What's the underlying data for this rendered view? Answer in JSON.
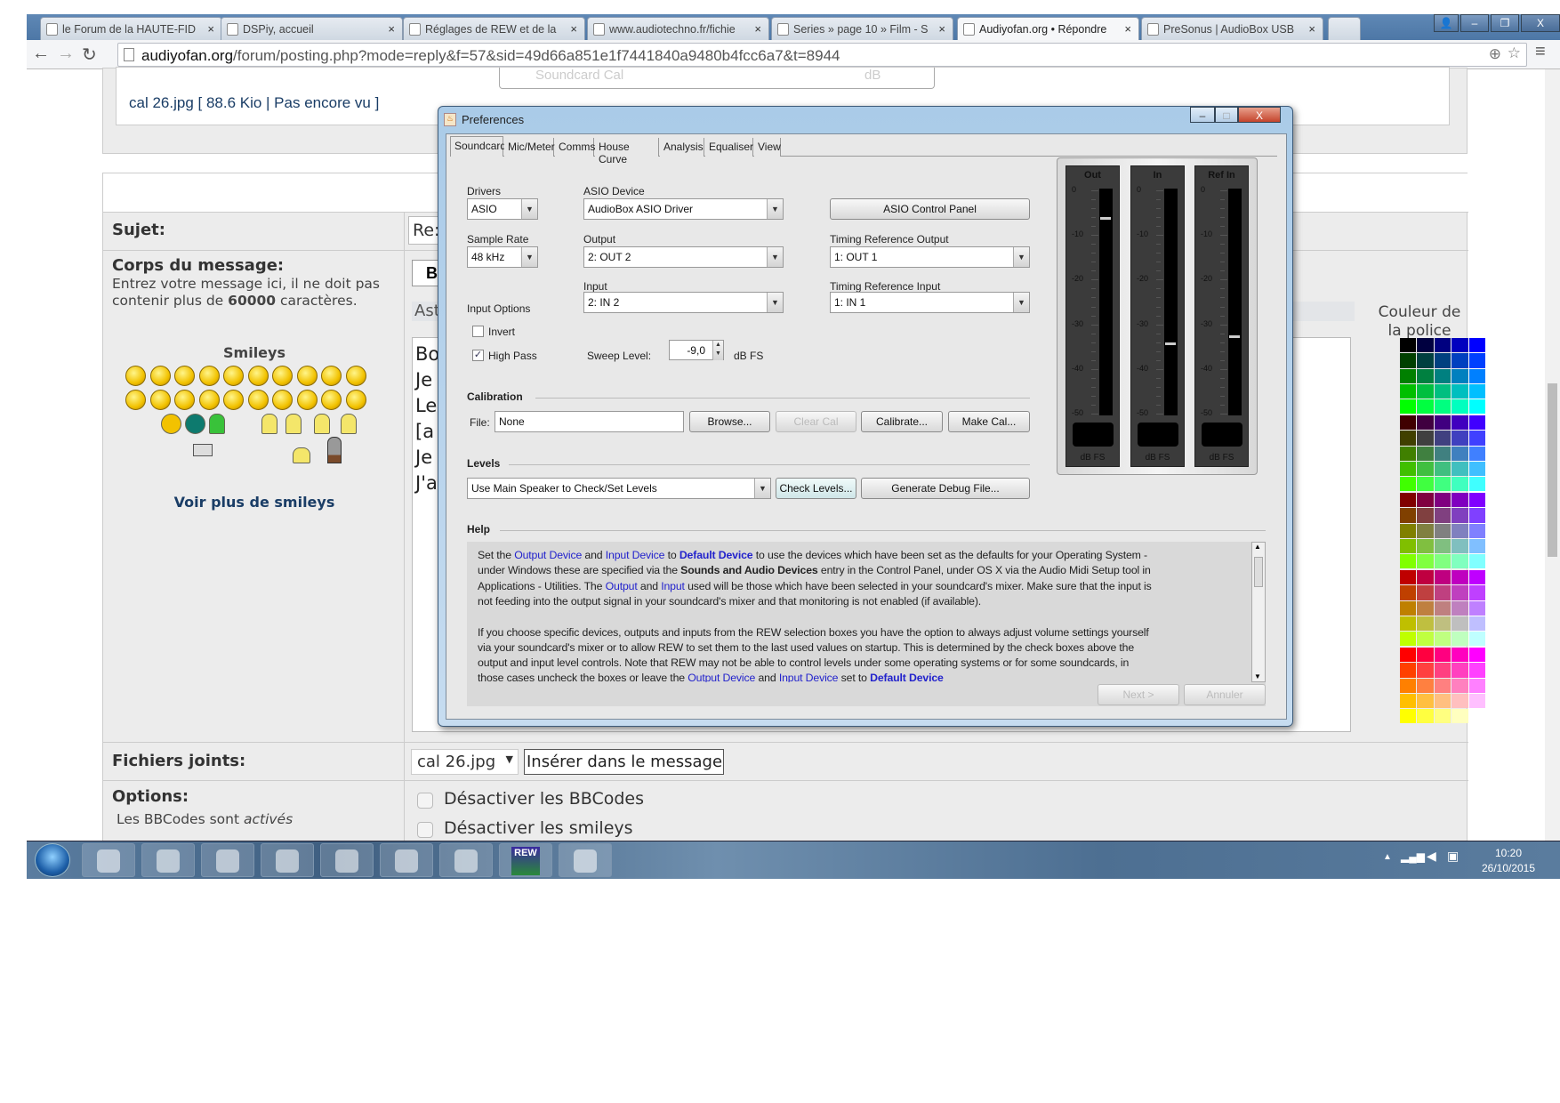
{
  "browser": {
    "tabs": [
      {
        "label": "le Forum de la HAUTE-FID",
        "active": false
      },
      {
        "label": "DSPiy, accueil",
        "active": false
      },
      {
        "label": "Réglages de REW et de la",
        "active": false
      },
      {
        "label": "www.audiotechno.fr/fichie",
        "active": false
      },
      {
        "label": "Series » page 10 » Film - S",
        "active": false
      },
      {
        "label": "Audiyofan.org • Répondre",
        "active": true
      },
      {
        "label": "PreSonus | AudioBox USB",
        "active": false
      }
    ],
    "url_domain": "audiyofan.org",
    "url_rest": "/forum/posting.php?mode=reply&f=57&sid=49d66a851e1f7441840a9480b4fcc6a7&t=8944"
  },
  "forum": {
    "attachment_line": "cal 26.jpg [ 88.6 Kio | Pas encore vu ]",
    "soundcard_cal_fragment": "Soundcard Cal",
    "soundcard_cal_unit": "dB",
    "subject_label": "Sujet:",
    "subject_value": "Re:",
    "body_label": "Corps du message:",
    "body_help_1": "Entrez votre message ici, il ne doit pas contenir plus de ",
    "body_help_count": "60000",
    "body_help_2": " caractères.",
    "smileys_title": "Smileys",
    "more_smileys": "Voir plus de smileys",
    "bold_button": "B",
    "hint_fragment": "Ast",
    "message_lines": [
      "Bo",
      "Je",
      "Le",
      "[a",
      "Je",
      "J'a"
    ],
    "font_color_title": "Couleur de la police",
    "palette_levels": [
      "00",
      "40",
      "80",
      "BF",
      "FF"
    ],
    "attachments_label": "Fichiers joints:",
    "attachment_select": "cal 26.jpg",
    "insert_button": "Insérer dans le message",
    "options_label": "Options:",
    "bbcode_status_1": "Les BBCodes sont ",
    "bbcode_status_2": "activés",
    "opt_disable_bbcode": "Désactiver les BBCodes",
    "opt_disable_smileys": "Désactiver les smileys"
  },
  "dialog": {
    "title": "Preferences",
    "tabs": [
      "Soundcard",
      "Mic/Meter",
      "Comms",
      "House Curve",
      "Analysis",
      "Equaliser",
      "View"
    ],
    "drivers_label": "Drivers",
    "drivers_value": "ASIO",
    "asio_device_label": "ASIO Device",
    "asio_device_value": "AudioBox ASIO Driver",
    "asio_control_panel": "ASIO Control Panel",
    "sample_rate_label": "Sample Rate",
    "sample_rate_value": "48 kHz",
    "output_label": "Output",
    "output_value": "2: OUT 2",
    "timing_out_label": "Timing Reference Output",
    "timing_out_value": "1: OUT 1",
    "input_label": "Input",
    "input_value": "2: IN 2",
    "timing_in_label": "Timing Reference Input",
    "timing_in_value": "1: IN 1",
    "input_options_label": "Input Options",
    "invert_label": "Invert",
    "invert_checked": false,
    "highpass_label": "High Pass",
    "highpass_checked": true,
    "sweep_label": "Sweep Level:",
    "sweep_value": "-9,0",
    "sweep_unit": "dB FS",
    "meters": [
      {
        "label": "Out",
        "peak_db": -6
      },
      {
        "label": "In",
        "peak_db": -34
      },
      {
        "label": "Ref In",
        "peak_db": -32.5
      }
    ],
    "meter_ticks": [
      "0",
      "-10",
      "-20",
      "-30",
      "-40",
      "-50"
    ],
    "meter_unit": "dB FS",
    "calibration_label": "Calibration",
    "file_label": "File:",
    "file_value": "None",
    "browse": "Browse...",
    "clear_cal": "Clear Cal",
    "calibrate": "Calibrate...",
    "make_cal": "Make Cal...",
    "levels_label": "Levels",
    "levels_value": "Use Main Speaker to Check/Set Levels",
    "check_levels": "Check Levels...",
    "debug_file": "Generate Debug File...",
    "help_label": "Help",
    "help_lines": [
      [
        [
          "Set the ",
          ""
        ],
        [
          "Output Device",
          "hl"
        ],
        [
          " and ",
          ""
        ],
        [
          "Input Device",
          "hl"
        ],
        [
          " to ",
          ""
        ],
        [
          "Default Device",
          "hlb"
        ],
        [
          " to use the devices which have been set as the defaults for your Operating System -",
          ""
        ]
      ],
      [
        [
          "under Windows these are specified via the ",
          ""
        ],
        [
          "Sounds and Audio Devices",
          "hb"
        ],
        [
          " entry in the Control Panel, under OS X via the Audio Midi Setup tool in",
          ""
        ]
      ],
      [
        [
          "Applications - Utilities. The ",
          ""
        ],
        [
          "Output",
          "hl"
        ],
        [
          " and ",
          ""
        ],
        [
          "Input",
          "hl"
        ],
        [
          " used will be those which have been selected in your soundcard's mixer. Make sure that the input is",
          ""
        ]
      ],
      [
        [
          "not feeding into the output signal in your soundcard's mixer and that monitoring is not enabled (if available).",
          ""
        ]
      ],
      [],
      [
        [
          "If you choose specific devices, outputs and inputs from the REW selection boxes you have the option to always adjust volume settings yourself",
          ""
        ]
      ],
      [
        [
          "via your soundcard's mixer or to allow REW to set them to the last used values on startup. This is determined by the check boxes above the",
          ""
        ]
      ],
      [
        [
          "output and input level controls. Note that REW may not be able to control levels under some operating systems or for some soundcards, in",
          ""
        ]
      ],
      [
        [
          "those cases uncheck the boxes or leave the ",
          ""
        ],
        [
          "Output Device",
          "hl"
        ],
        [
          " and ",
          ""
        ],
        [
          "Input Device",
          "hl"
        ],
        [
          " set to ",
          ""
        ],
        [
          "Default Device",
          "hlb"
        ]
      ]
    ],
    "next": "Next >",
    "cancel": "Annuler"
  },
  "taskbar": {
    "apps": [
      "explorer",
      "media-player",
      "chrome",
      "notepad",
      "ccleaner",
      "control-panel",
      "usb-tool",
      "REW",
      "speaker"
    ],
    "rew_label": "REW",
    "time": "10:20",
    "date": "26/10/2015"
  }
}
